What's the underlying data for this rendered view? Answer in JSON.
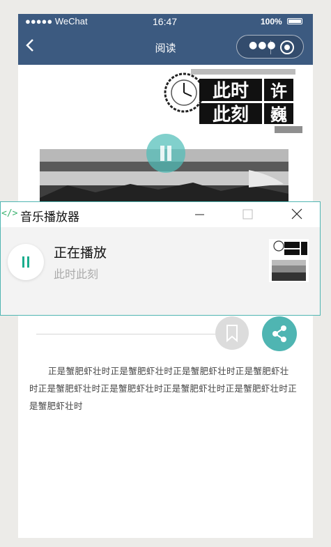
{
  "statusbar": {
    "carrier": "●●●●● WeChat",
    "time": "16:47",
    "battery": "100%"
  },
  "navbar": {
    "back_icon": "chevron-left-icon",
    "title": "阅读",
    "more_icon": "more-dots-icon",
    "close_icon": "record-circle-icon"
  },
  "article": {
    "logo_text": [
      "此时",
      "许",
      "此刻",
      "巍"
    ],
    "body": "正是蟹肥虾壮时正是蟹肥虾壮时正是蟹肥虾壮时正是蟹肥虾壮时正是蟹肥虾壮时正是蟹肥虾壮时正是蟹肥虾壮时正是蟹肥虾壮时正是蟹肥虾壮时"
  },
  "player": {
    "app_title": "音乐播放器",
    "status": "正在播放",
    "track": "此时此刻"
  },
  "colors": {
    "nav_bg": "#3c5a80",
    "accent": "#4fb5b2",
    "play_green": "#1aad8e"
  }
}
